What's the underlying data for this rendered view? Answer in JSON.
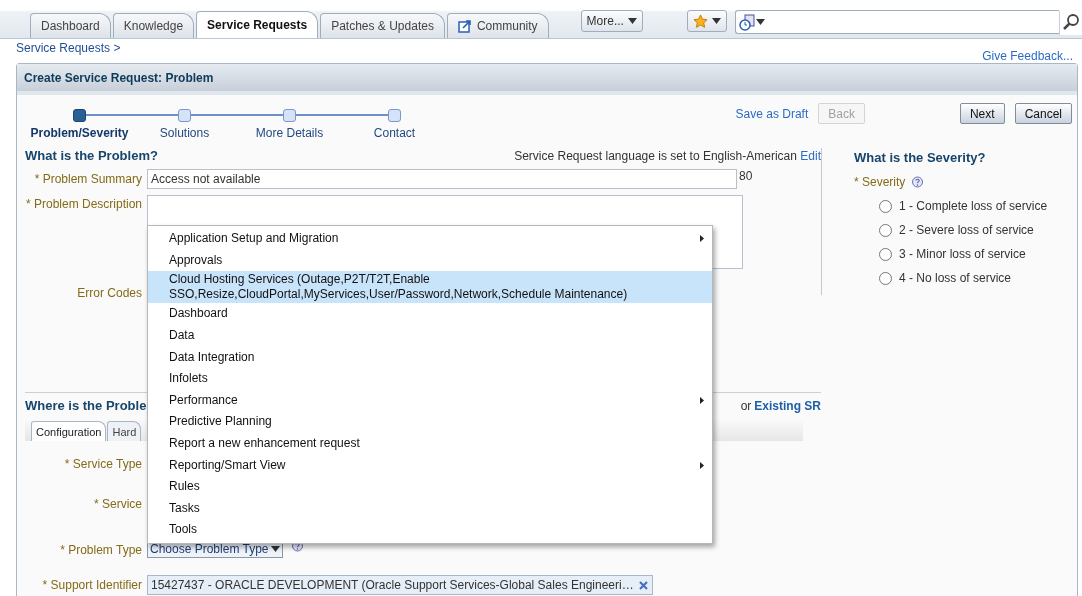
{
  "top_tabs": [
    {
      "label": "Dashboard",
      "selected": false,
      "kind": "plain"
    },
    {
      "label": "Knowledge",
      "selected": false,
      "kind": "plain"
    },
    {
      "label": "Service Requests",
      "selected": true,
      "kind": "plain"
    },
    {
      "label": "Patches & Updates",
      "selected": false,
      "kind": "plain"
    },
    {
      "label": "Community",
      "selected": false,
      "kind": "external"
    }
  ],
  "more_button": "More...",
  "breadcrumb": "Service Requests >",
  "feedback_link": "Give Feedback...",
  "panel_title": "Create Service Request: Problem",
  "train": [
    {
      "label": "Problem/Severity",
      "selected": true
    },
    {
      "label": "Solutions",
      "selected": false
    },
    {
      "label": "More Details",
      "selected": false
    },
    {
      "label": "Contact",
      "selected": false
    }
  ],
  "actions": [
    {
      "label": "Save as Draft",
      "kind": "link"
    },
    {
      "label": "Back",
      "kind": "button",
      "disabled": true
    },
    {
      "label": "Next",
      "kind": "button",
      "disabled": false
    },
    {
      "label": "Cancel",
      "kind": "button",
      "disabled": false
    }
  ],
  "problem": {
    "heading": "What is the Problem?",
    "language_note": "Service Request language is set to English-American",
    "language_edit": "Edit",
    "summary_label": "* Problem Summary",
    "summary_value": "Access not available",
    "summary_count": "80",
    "description_label": "* Problem Description",
    "error_codes_label": "Error Codes"
  },
  "severity": {
    "heading": "What is the Severity?",
    "label": "* Severity",
    "options": [
      {
        "label": "1 - Complete loss of service",
        "selected": false
      },
      {
        "label": "2 - Severe loss of service",
        "selected": false
      },
      {
        "label": "3 - Minor loss of service",
        "selected": false
      },
      {
        "label": "4 - No loss of service",
        "selected": false
      }
    ]
  },
  "location": {
    "heading": "Where is the Proble",
    "existing_prefix": "or",
    "existing_link": "Existing SR",
    "tabs": [
      {
        "label": "Configuration",
        "selected": true
      },
      {
        "label": "Hard",
        "selected": false
      }
    ],
    "fields": [
      {
        "label": "* Service Type",
        "kind": "hidden"
      },
      {
        "label": "* Service",
        "kind": "hidden"
      },
      {
        "label": "* Problem Type",
        "kind": "select",
        "value": "Choose Problem Type"
      },
      {
        "label": "* Support Identifier",
        "kind": "token",
        "value": "15427437 - ORACLE DEVELOPMENT (Oracle Support Services-Global Sales Engineeri…"
      }
    ]
  },
  "menu": {
    "items": [
      {
        "label": "Application Setup and Migration",
        "selected": false,
        "has_submenu": true
      },
      {
        "label": "Approvals",
        "selected": false,
        "has_submenu": false
      },
      {
        "label": "Cloud Hosting Services (Outage,P2T/T2T,Enable SSO,Resize,CloudPortal,MyServices,User/Password,Network,Schedule Maintenance)",
        "selected": true,
        "has_submenu": false
      },
      {
        "label": "Dashboard",
        "selected": false,
        "has_submenu": false
      },
      {
        "label": "Data",
        "selected": false,
        "has_submenu": false
      },
      {
        "label": "Data Integration",
        "selected": false,
        "has_submenu": false
      },
      {
        "label": "Infolets",
        "selected": false,
        "has_submenu": false
      },
      {
        "label": "Performance",
        "selected": false,
        "has_submenu": true
      },
      {
        "label": "Predictive Planning",
        "selected": false,
        "has_submenu": false
      },
      {
        "label": "Report a new enhancement request",
        "selected": false,
        "has_submenu": false
      },
      {
        "label": "Reporting/Smart View",
        "selected": false,
        "has_submenu": true
      },
      {
        "label": "Rules",
        "selected": false,
        "has_submenu": false
      },
      {
        "label": "Tasks",
        "selected": false,
        "has_submenu": false
      },
      {
        "label": "Tools",
        "selected": false,
        "has_submenu": false
      }
    ]
  }
}
